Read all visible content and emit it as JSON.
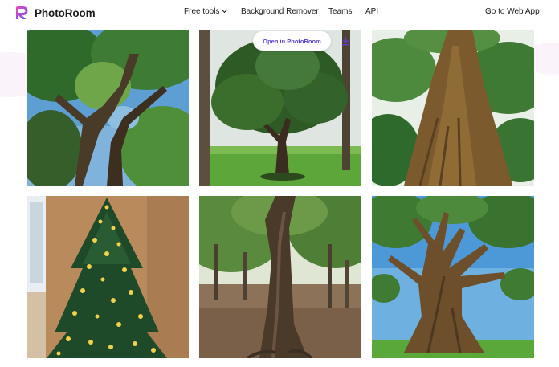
{
  "brand": {
    "name": "PhotoRoom",
    "accent": "#6b4ff5"
  },
  "nav": {
    "free_tools": "Free tools",
    "background_remover": "Background Remover",
    "teams": "Teams",
    "api": "API",
    "web_app": "Go to Web App"
  },
  "overlay": {
    "open_label": "Open in PhotoRoom",
    "download_icon": "download-icon"
  },
  "gallery": {
    "images": [
      {
        "subject": "tree canopy viewed from below against blue sky"
      },
      {
        "subject": "lone tree on green meadow"
      },
      {
        "subject": "large tree trunk viewed from below"
      },
      {
        "subject": "decorated christmas tree with golden lights"
      },
      {
        "subject": "twisted tree trunk in autumn forest"
      },
      {
        "subject": "large tree with spreading branches under blue sky"
      }
    ]
  }
}
